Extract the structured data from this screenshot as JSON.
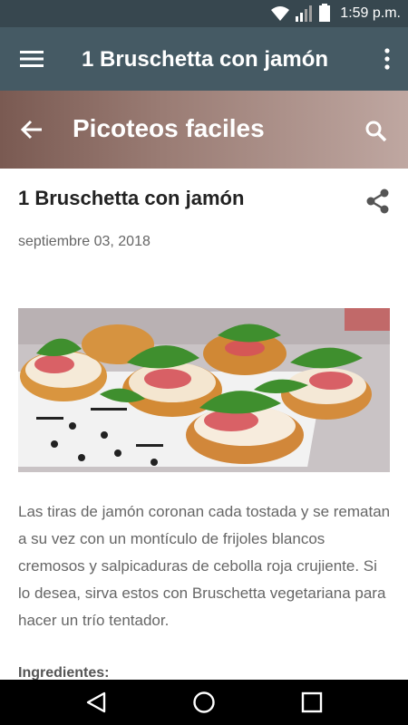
{
  "status_bar": {
    "time": "1:59 p.m.",
    "icons": [
      "wifi-icon",
      "signal-icon",
      "battery-icon"
    ]
  },
  "app_bar": {
    "title": "1 Bruschetta con jamón",
    "menu_icon": "hamburger-menu-icon",
    "overflow_icon": "more-vertical-icon"
  },
  "header": {
    "title": "Picoteos faciles",
    "back_icon": "arrow-back-icon",
    "search_icon": "search-icon"
  },
  "post": {
    "title": "1 Bruschetta con jamón",
    "date": "septiembre 03, 2018",
    "share_icon": "share-icon",
    "image_alt": "bruschetta",
    "body": "Las tiras de jamón coronan cada tostada y se rematan a su vez con un montículo de frijoles blancos cremosos y salpicaduras de cebolla roja crujiente. Si lo desea, sirva estos con Bruschetta vegetariana para hacer un trío tentador.",
    "ingredients_heading": "Ingredientes:"
  },
  "nav_bar": {
    "buttons": [
      "back-triangle-icon",
      "home-circle-icon",
      "recents-square-icon"
    ]
  },
  "colors": {
    "status_bar": "#37474f",
    "app_bar": "#455a64",
    "header_start": "#7a5a52",
    "header_end": "#bfa7a1",
    "body_text": "#666666"
  }
}
